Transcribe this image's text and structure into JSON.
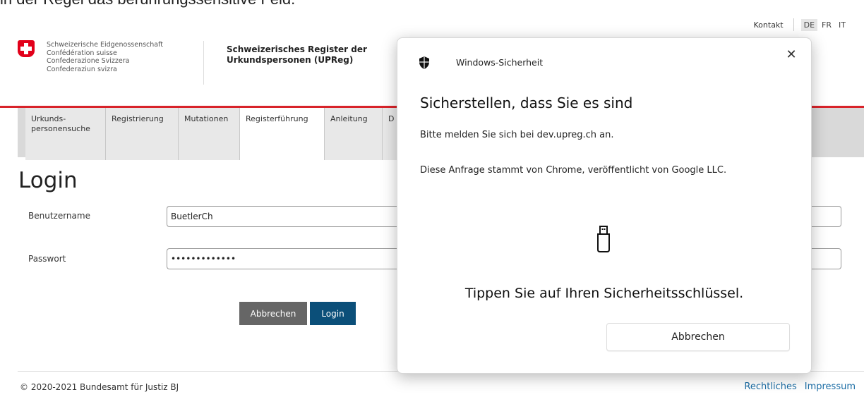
{
  "caption": "in der Regel das berührungssensitive Feld.",
  "header": {
    "contact": "Kontakt",
    "languages": [
      "DE",
      "FR",
      "IT"
    ],
    "confederation": [
      "Schweizerische Eidgenossenschaft",
      "Confédération suisse",
      "Confederazione Svizzera",
      "Confederaziun svizra"
    ],
    "register_title_line1": "Schweizerisches Register der",
    "register_title_line2": "Urkundspersonen (UPReg)"
  },
  "nav": {
    "tabs": [
      "Urkunds-\npersonensuche",
      "Registrierung",
      "Mutationen",
      "Registerführung",
      "Anleitung",
      "D"
    ]
  },
  "login": {
    "title": "Login",
    "username_label": "Benutzername",
    "username_value": "BuetlerCh",
    "password_label": "Passwort",
    "password_value": "•••••••••••••",
    "cancel_label": "Abbrechen",
    "login_label": "Login"
  },
  "footer": {
    "copyright": "© 2020-2021 Bundesamt für Justiz BJ",
    "links": [
      "Rechtliches",
      "Impressum"
    ]
  },
  "dialog": {
    "app_name": "Windows-Sicherheit",
    "heading": "Sicherstellen, dass Sie es sind",
    "text1": "Bitte melden Sie sich bei dev.upreg.ch an.",
    "text2": "Diese Anfrage stammt von Chrome, veröffentlicht von Google LLC.",
    "instruction": "Tippen Sie auf Ihren Sicherheitsschlüssel.",
    "cancel_label": "Abbrechen",
    "close_glyph": "✕"
  },
  "colors": {
    "swiss_red": "#e2001a",
    "login_blue": "#0b4f79",
    "link_blue": "#1b6da5"
  }
}
